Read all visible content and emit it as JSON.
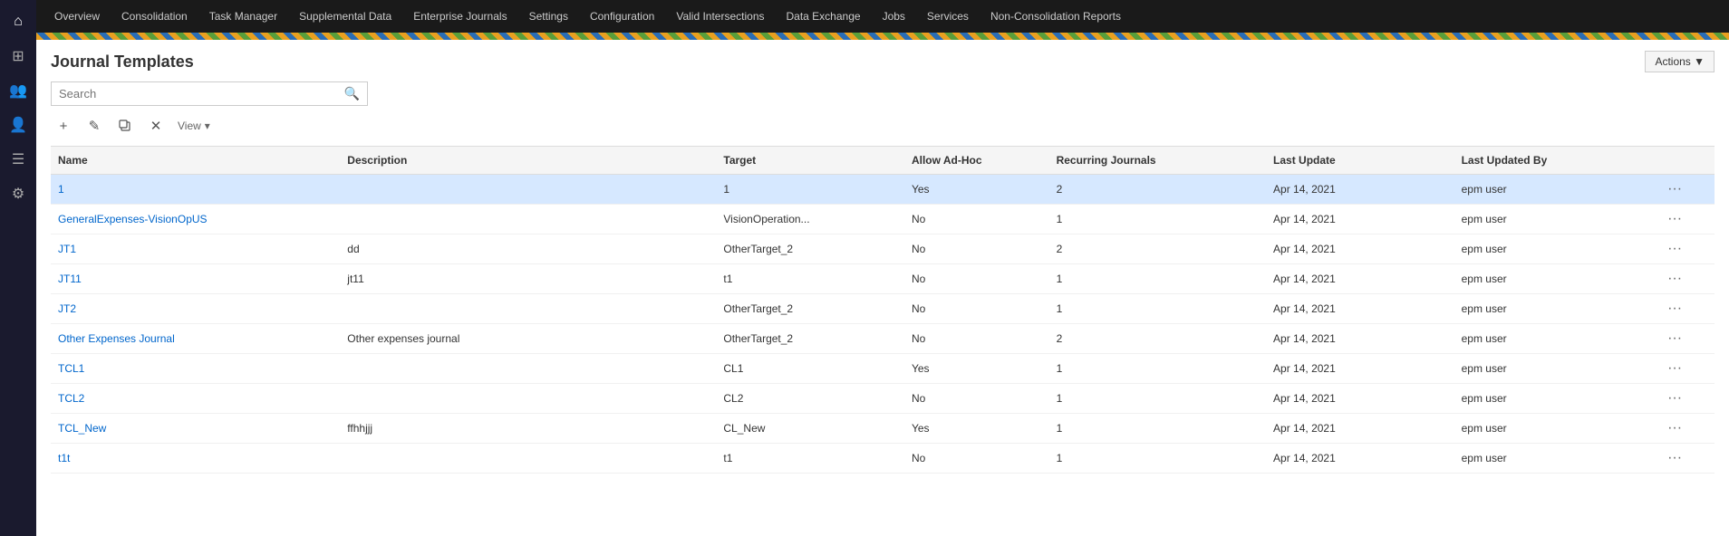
{
  "nav": {
    "items": [
      {
        "label": "Overview"
      },
      {
        "label": "Consolidation"
      },
      {
        "label": "Task Manager"
      },
      {
        "label": "Supplemental Data"
      },
      {
        "label": "Enterprise Journals"
      },
      {
        "label": "Settings"
      },
      {
        "label": "Configuration"
      },
      {
        "label": "Valid Intersections"
      },
      {
        "label": "Data Exchange"
      },
      {
        "label": "Jobs"
      },
      {
        "label": "Services"
      },
      {
        "label": "Non-Consolidation Reports"
      }
    ]
  },
  "sidebar": {
    "icons": [
      {
        "name": "home-icon",
        "symbol": "⌂"
      },
      {
        "name": "grid-icon",
        "symbol": "⊞"
      },
      {
        "name": "user-group-icon",
        "symbol": "👤"
      },
      {
        "name": "person-icon",
        "symbol": "🧑"
      },
      {
        "name": "list-icon",
        "symbol": "≡"
      },
      {
        "name": "settings-icon",
        "symbol": "⚙"
      }
    ]
  },
  "page": {
    "title": "Journal Templates",
    "actions_label": "Actions ▼",
    "search_placeholder": "Search",
    "view_label": "View"
  },
  "toolbar": {
    "add_label": "+",
    "edit_label": "✎",
    "copy_label": "⧉",
    "delete_label": "✕"
  },
  "table": {
    "columns": [
      "Name",
      "Description",
      "Target",
      "Allow Ad-Hoc",
      "Recurring Journals",
      "Last Update",
      "Last Updated By",
      ""
    ],
    "rows": [
      {
        "name": "1",
        "description": "",
        "target": "1",
        "allow_adhoc": "Yes",
        "recurring": "2",
        "last_update": "Apr 14, 2021",
        "last_updated_by": "epm user",
        "selected": true
      },
      {
        "name": "GeneralExpenses-VisionOpUS",
        "description": "",
        "target": "VisionOperation...",
        "allow_adhoc": "No",
        "recurring": "1",
        "last_update": "Apr 14, 2021",
        "last_updated_by": "epm user",
        "selected": false
      },
      {
        "name": "JT1",
        "description": "dd",
        "target": "OtherTarget_2",
        "allow_adhoc": "No",
        "recurring": "2",
        "last_update": "Apr 14, 2021",
        "last_updated_by": "epm user",
        "selected": false
      },
      {
        "name": "JT11",
        "description": "jt11",
        "target": "t1",
        "allow_adhoc": "No",
        "recurring": "1",
        "last_update": "Apr 14, 2021",
        "last_updated_by": "epm user",
        "selected": false
      },
      {
        "name": "JT2",
        "description": "",
        "target": "OtherTarget_2",
        "allow_adhoc": "No",
        "recurring": "1",
        "last_update": "Apr 14, 2021",
        "last_updated_by": "epm user",
        "selected": false
      },
      {
        "name": "Other Expenses Journal",
        "description": "Other expenses journal",
        "target": "OtherTarget_2",
        "allow_adhoc": "No",
        "recurring": "2",
        "last_update": "Apr 14, 2021",
        "last_updated_by": "epm user",
        "selected": false
      },
      {
        "name": "TCL1",
        "description": "",
        "target": "CL1",
        "allow_adhoc": "Yes",
        "recurring": "1",
        "last_update": "Apr 14, 2021",
        "last_updated_by": "epm user",
        "selected": false
      },
      {
        "name": "TCL2",
        "description": "",
        "target": "CL2",
        "allow_adhoc": "No",
        "recurring": "1",
        "last_update": "Apr 14, 2021",
        "last_updated_by": "epm user",
        "selected": false
      },
      {
        "name": "TCL_New",
        "description": "ffhhjjj",
        "target": "CL_New",
        "allow_adhoc": "Yes",
        "recurring": "1",
        "last_update": "Apr 14, 2021",
        "last_updated_by": "epm user",
        "selected": false
      },
      {
        "name": "t1t",
        "description": "",
        "target": "t1",
        "allow_adhoc": "No",
        "recurring": "1",
        "last_update": "Apr 14, 2021",
        "last_updated_by": "epm user",
        "selected": false
      }
    ]
  }
}
